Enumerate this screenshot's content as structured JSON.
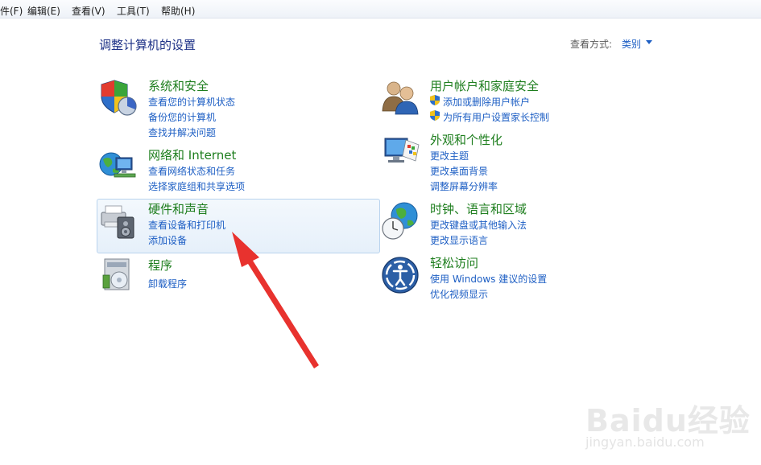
{
  "menu": {
    "file": "件(F)",
    "edit": "编辑(E)",
    "view": "查看(V)",
    "tools": "工具(T)",
    "help": "帮助(H)"
  },
  "page": {
    "title": "调整计算机的设置",
    "view_by_label": "查看方式:",
    "view_by_value": "类别"
  },
  "categories": {
    "system_security": {
      "title": "系统和安全",
      "links": [
        "查看您的计算机状态",
        "备份您的计算机",
        "查找并解决问题"
      ]
    },
    "network": {
      "title": "网络和 Internet",
      "links": [
        "查看网络状态和任务",
        "选择家庭组和共享选项"
      ]
    },
    "hardware_sound": {
      "title": "硬件和声音",
      "links": [
        "查看设备和打印机",
        "添加设备"
      ]
    },
    "programs": {
      "title": "程序",
      "links": [
        "卸载程序"
      ]
    },
    "user_accounts": {
      "title": "用户帐户和家庭安全",
      "links": [
        "添加或删除用户帐户",
        "为所有用户设置家长控制"
      ]
    },
    "appearance": {
      "title": "外观和个性化",
      "links": [
        "更改主题",
        "更改桌面背景",
        "调整屏幕分辨率"
      ]
    },
    "clock_region": {
      "title": "时钟、语言和区域",
      "links": [
        "更改键盘或其他输入法",
        "更改显示语言"
      ]
    },
    "ease_access": {
      "title": "轻松访问",
      "links": [
        "使用 Windows 建议的设置",
        "优化视频显示"
      ]
    }
  },
  "watermark": {
    "logo": "Baidu经验",
    "url": "jingyan.baidu.com"
  },
  "colors": {
    "category_title": "#1e7e1e",
    "link": "#1e5fc4",
    "arrow": "#e8322e"
  },
  "icons": {
    "system_security": "shield-pie-icon",
    "network": "globe-network-icon",
    "hardware_sound": "printer-speaker-icon",
    "programs": "programs-box-icon",
    "user_accounts": "users-icon",
    "appearance": "monitor-paint-icon",
    "clock_region": "globe-clock-icon",
    "ease_access": "ease-of-access-icon"
  }
}
